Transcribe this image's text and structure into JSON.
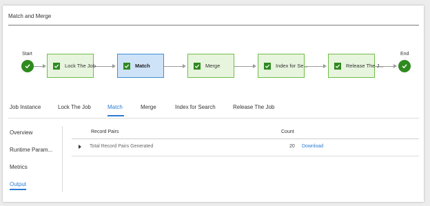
{
  "panel": {
    "title": "Match and Merge"
  },
  "workflow": {
    "start_label": "Start",
    "end_label": "End",
    "steps": [
      {
        "label": "Lock The Job",
        "status": "done",
        "active": false
      },
      {
        "label": "Match",
        "status": "done",
        "active": true
      },
      {
        "label": "Merge",
        "status": "done",
        "active": false
      },
      {
        "label": "Index for Se...",
        "status": "done",
        "active": false
      },
      {
        "label": "Release The J...",
        "status": "done",
        "active": false
      }
    ]
  },
  "tabs": [
    {
      "label": "Job Instance",
      "active": false
    },
    {
      "label": "Lock The Job",
      "active": false
    },
    {
      "label": "Match",
      "active": true
    },
    {
      "label": "Merge",
      "active": false
    },
    {
      "label": "Index for Search",
      "active": false
    },
    {
      "label": "Release The Job",
      "active": false
    }
  ],
  "left_nav": [
    {
      "label": "Overview",
      "active": false
    },
    {
      "label": "Runtime Param...",
      "active": false
    },
    {
      "label": "Metrics",
      "active": false
    },
    {
      "label": "Output",
      "active": true
    }
  ],
  "table": {
    "columns": {
      "record_pairs": "Record Pairs",
      "count": "Count"
    },
    "rows": [
      {
        "name": "Total Record Pairs Generated",
        "count": "20",
        "action": "Download"
      }
    ]
  },
  "colors": {
    "success": "#2f8a1f",
    "accent": "#2a7bd3",
    "node_fill": "#e8f5de",
    "node_active_fill": "#cfe3f8"
  }
}
